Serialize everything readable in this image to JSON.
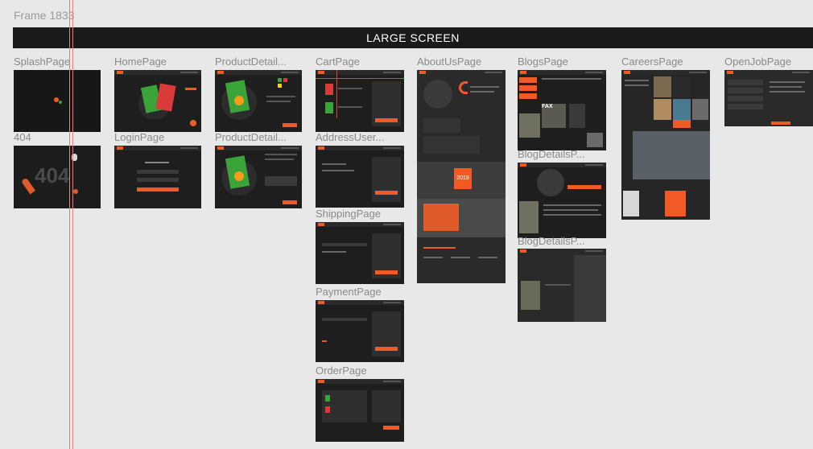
{
  "frame": {
    "title": "Frame 1833"
  },
  "banner": {
    "label": "LARGE SCREEN"
  },
  "pages": {
    "splash": "SplashPage",
    "home": "HomePage",
    "product1": "ProductDetail...",
    "cart": "CartPage",
    "about": "AboutUsPage",
    "blogs": "BlogsPage",
    "careers": "CareersPage",
    "openjob": "OpenJobPage",
    "notfound": "404",
    "login": "LoginPage",
    "product2": "ProductDetail...",
    "address": "AddressUser...",
    "blogdetail1": "BlogDetailsP...",
    "shipping": "ShippingPage",
    "blogdetail2": "BlogDetailsP...",
    "payment": "PaymentPage",
    "order": "OrderPage"
  },
  "thumb_text": {
    "notfound_code": "404",
    "about_year": "2019",
    "blogs_fax": "FAX"
  },
  "colors": {
    "accent": "#f15a24",
    "dark": "#1e1e1e",
    "green": "#3aa33a",
    "guide": "#f07b7b"
  }
}
